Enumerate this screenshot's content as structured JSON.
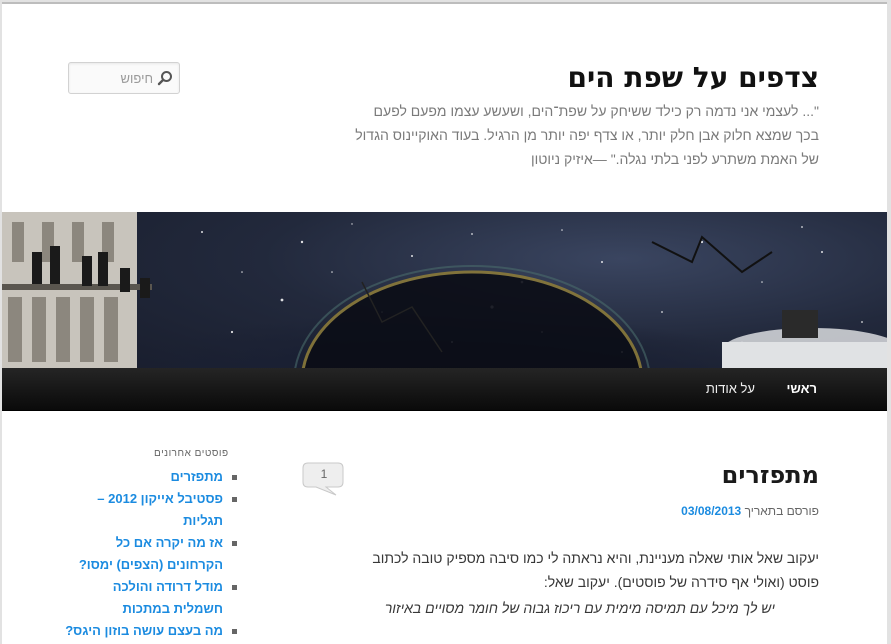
{
  "header": {
    "site_title": "צדפים על שפת הים",
    "tagline_lines": [
      "\"... לעצמי אני נדמה רק כילד ששיחק על שפת־הים, ושעשע עצמו מפעם לפעם",
      "בכך שמצא חלוק אבן חלק יותר, או צדף יפה יותר מן הרגיל. בעוד האוקיינוס הגדול",
      "של האמת משתרע לפני בלתי נגלה.\"     —איזיק ניוטון"
    ]
  },
  "search": {
    "placeholder": "חיפוש",
    "icon": "search-icon"
  },
  "nav": {
    "items": [
      "ראשי",
      "על אודות"
    ]
  },
  "post": {
    "title": "מתפזרים",
    "comment_count": "1",
    "posted_on_label": "פורסם בתאריך",
    "date": "03/08/2013",
    "paragraphs": [
      "יעקוב שאל אותי שאלה מעניינת, והיא נראתה לי כמו סיבה מספיק טובה לכתוב",
      "פוסט (ואולי אף סידרה של פוסטים). יעקוב שאל:"
    ],
    "quote": "יש לך מיכל עם תמיסה מימית עם ריכוז גבוה של חומר מסויים באיזור"
  },
  "sidebar": {
    "widget_title": "פוסטים אחרונים",
    "recent_posts": [
      "מתפזרים",
      "פסטיבל אייקון 2012 – תגליות",
      "אז מה יקרה אם כל הקרחונים (הצפים) ימסו?",
      "מודל דרודה והולכה חשמלית במתכות",
      "מה בעצם עושה בוזון היגס?"
    ]
  },
  "colors": {
    "link": "#1b8be0",
    "nav_bg": "#111111",
    "page_bg": "#e2e2e2"
  }
}
